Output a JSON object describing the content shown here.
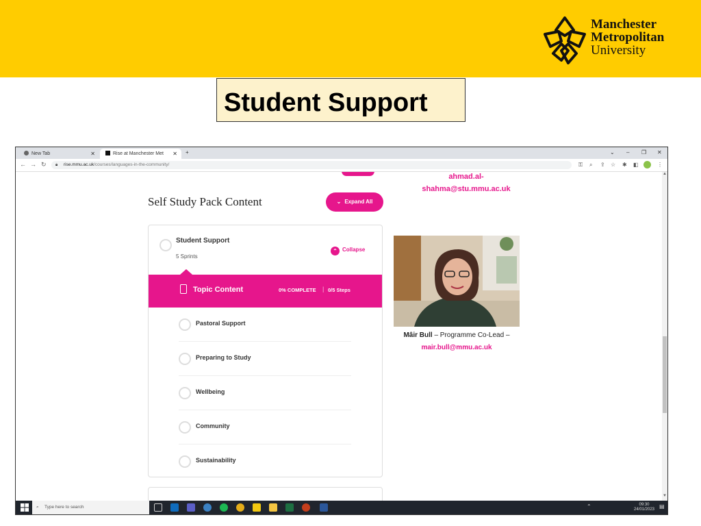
{
  "slide": {
    "title": "Student Support",
    "logo": {
      "line1": "Manchester",
      "line2": "Metropolitan",
      "line3": "University",
      "icon": "mmu-flower-logo"
    },
    "colors": {
      "banner": "#ffcc00",
      "accent": "#e6168c",
      "title_box": "#fdf2cc"
    }
  },
  "browser": {
    "tabs": [
      {
        "label": "New Tab",
        "icon": "chrome-icon"
      },
      {
        "label": "Rise at Manchester Met",
        "icon": "rise-icon"
      }
    ],
    "new_tab": "+",
    "url_host": "rise.mmu.ac.uk",
    "url_path": "/courses/languages-in-the-community/"
  },
  "page": {
    "top_email": "ahmad.al-\nshahma@stu.mmu.ac.uk",
    "top_email_line1": "ahmad.al-",
    "top_email_line2": "shahma@stu.mmu.ac.uk",
    "heading": "Self Study Pack Content",
    "expand_all": "Expand All",
    "section": {
      "title": "Student Support",
      "subtitle": "5 Sprints",
      "collapse": "Collapse",
      "topic": {
        "label": "Topic Content",
        "complete": "0% COMPLETE",
        "steps": "0/5 Steps"
      },
      "lessons": [
        "Pastoral Support",
        "Preparing to Study",
        "Wellbeing",
        "Community",
        "Sustainability"
      ]
    },
    "profile": {
      "name": "Mâir Bull",
      "role": " – Programme Co-Lead –",
      "email": "mair.bull@mmu.ac.uk"
    }
  },
  "taskbar": {
    "search_placeholder": "Type here to search",
    "time": "09:30",
    "date": "24/01/2023"
  }
}
